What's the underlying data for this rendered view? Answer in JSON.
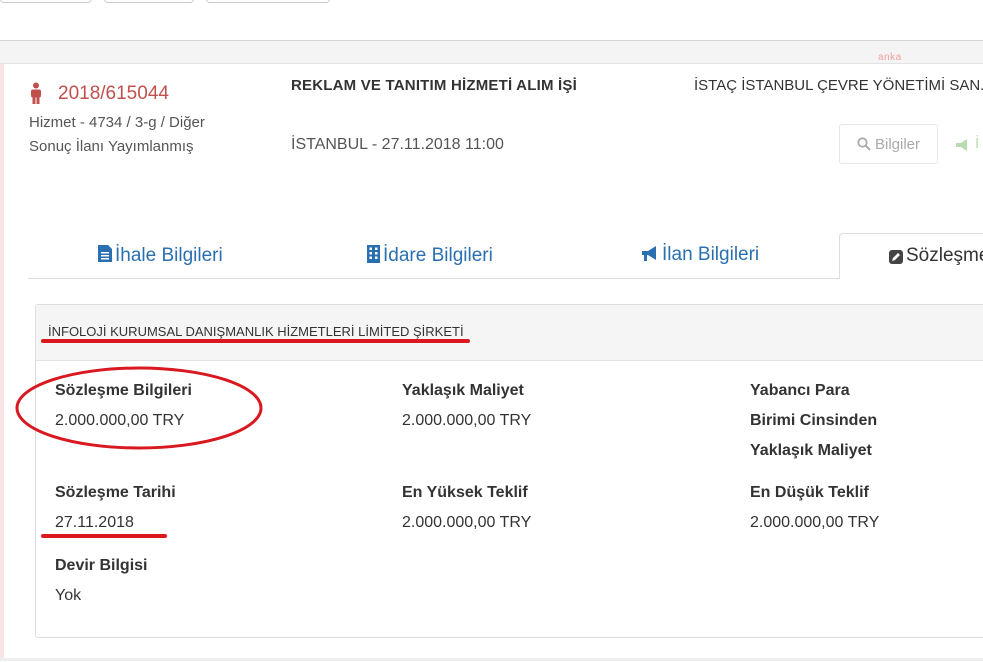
{
  "watermark": "anka",
  "header": {
    "tender_no": "2018/615044",
    "meta_line1": "Hizmet - 4734 / 3-g / Diğer",
    "meta_line2": "Sonuç İlanı Yayımlanmış",
    "title": "REKLAM VE TANITIM HİZMETİ ALIM İŞİ",
    "location": "İSTANBUL - 27.11.2018 11:00",
    "organization": "İSTAÇ İSTANBUL ÇEVRE YÖNETİMİ SAN. V",
    "info_button": "Bilgiler",
    "next_button": "İ"
  },
  "tabs": [
    {
      "label": "İhale Bilgileri",
      "icon": "document-icon"
    },
    {
      "label": "İdare Bilgileri",
      "icon": "building-icon"
    },
    {
      "label": "İlan Bilgileri",
      "icon": "megaphone-icon"
    },
    {
      "label": "Sözleşme",
      "icon": "edit-icon",
      "active": true
    }
  ],
  "panel": {
    "company": "İNFOLOJİ KURUMSAL DANIŞMANLIK HİZMETLERİ LİMİTED ŞİRKETİ",
    "fields": {
      "contract_info": {
        "label": "Sözleşme Bilgileri",
        "value": "2.000.000,00 TRY"
      },
      "approx_cost": {
        "label": "Yaklaşık Maliyet",
        "value": "2.000.000,00 TRY"
      },
      "foreign_cost": {
        "label_line1": "Yabancı Para",
        "label_line2": "Birimi Cinsinden",
        "label_line3": "Yaklaşık Maliyet"
      },
      "contract_date": {
        "label": "Sözleşme Tarihi",
        "value": "27.11.2018"
      },
      "highest_offer": {
        "label": "En Yüksek Teklif",
        "value": "2.000.000,00 TRY"
      },
      "lowest_offer": {
        "label": "En Düşük Teklif",
        "value": "2.000.000,00 TRY"
      },
      "transfer_info": {
        "label": "Devir Bilgisi",
        "value": "Yok"
      }
    }
  },
  "colors": {
    "accent": "#c0504d",
    "link": "#2a6fb0",
    "annotation": "#d9181f"
  }
}
